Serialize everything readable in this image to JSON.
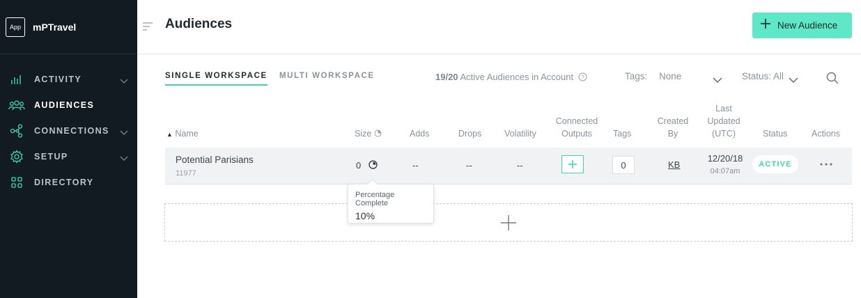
{
  "app": {
    "logo_text": "App",
    "name": "mPTravel"
  },
  "sidebar": {
    "items": [
      {
        "label": "ACTIVITY",
        "icon": "bar-chart-icon",
        "has_chevron": true,
        "active": false
      },
      {
        "label": "AUDIENCES",
        "icon": "people-icon",
        "has_chevron": false,
        "active": true
      },
      {
        "label": "CONNECTIONS",
        "icon": "nodes-icon",
        "has_chevron": true,
        "active": false
      },
      {
        "label": "SETUP",
        "icon": "gear-icon",
        "has_chevron": true,
        "active": false
      },
      {
        "label": "DIRECTORY",
        "icon": "grid-icon",
        "has_chevron": false,
        "active": false
      }
    ]
  },
  "header": {
    "title": "Audiences",
    "new_button_label": "New Audience"
  },
  "tabs": [
    {
      "label": "SINGLE WORKSPACE",
      "active": true
    },
    {
      "label": "MULTI WORKSPACE",
      "active": false
    }
  ],
  "quota": {
    "count": "19/20",
    "label": "Active Audiences in Account"
  },
  "filters": {
    "tags_label": "Tags:",
    "tags_value": "None",
    "status_label": "Status: All"
  },
  "table": {
    "headers": {
      "name": "Name",
      "size": "Size",
      "adds": "Adds",
      "drops": "Drops",
      "volatility": "Volatility",
      "connected_outputs_1": "Connected",
      "connected_outputs_2": "Outputs",
      "tags": "Tags",
      "created_by_1": "Created",
      "created_by_2": "By",
      "last_updated_1": "Last",
      "last_updated_2": "Updated",
      "last_updated_3": "(UTC)",
      "status": "Status",
      "actions": "Actions"
    },
    "rows": [
      {
        "name": "Potential Parisians",
        "id": "11977",
        "size": "0",
        "adds": "--",
        "drops": "--",
        "volatility": "--",
        "tags": "0",
        "created_by": "KB",
        "updated_date": "12/20/18",
        "updated_time": "04:07am",
        "status": "ACTIVE"
      }
    ]
  },
  "tooltip": {
    "title": "Percentage Complete",
    "value": "10%"
  },
  "colors": {
    "accent": "#3fd6b0",
    "button": "#5fe8c7",
    "sidebar": "#121b21"
  }
}
